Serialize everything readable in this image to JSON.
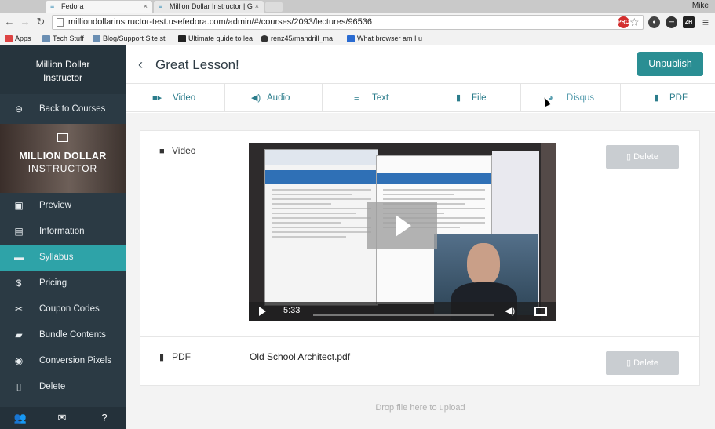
{
  "browser": {
    "tabs": [
      {
        "title": "Fedora",
        "active": true
      },
      {
        "title": "Million Dollar Instructor | G",
        "active": false
      }
    ],
    "user": "Mike",
    "url": "milliondollarinstructor-test.usefedora.com/admin/#/courses/2093/lectures/96536",
    "bookmarks": [
      "Apps",
      "Tech Stuff",
      "Blog/Support Site st",
      "Ultimate guide to lea",
      "renz45/mandrill_ma",
      "What browser am I u"
    ],
    "ext_labels": [
      "PRO",
      "ZH"
    ]
  },
  "sidebar": {
    "brand": "Million Dollar Instructor",
    "back": "Back to Courses",
    "logo_line1": "MILLION DOLLAR",
    "logo_line2": "INSTRUCTOR",
    "items": [
      {
        "label": "Preview",
        "icon": "image-icon"
      },
      {
        "label": "Information",
        "icon": "document-icon"
      },
      {
        "label": "Syllabus",
        "icon": "book-icon",
        "active": true
      },
      {
        "label": "Pricing",
        "icon": "dollar-icon"
      },
      {
        "label": "Coupon Codes",
        "icon": "scissors-icon"
      },
      {
        "label": "Bundle Contents",
        "icon": "folder-icon"
      },
      {
        "label": "Conversion Pixels",
        "icon": "target-icon"
      },
      {
        "label": "Delete",
        "icon": "trash-icon"
      }
    ]
  },
  "header": {
    "title": "Great Lesson!",
    "unpublish": "Unpublish"
  },
  "tabs": [
    {
      "label": "Video",
      "icon": "video-camera-icon"
    },
    {
      "label": "Audio",
      "icon": "speaker-icon"
    },
    {
      "label": "Text",
      "icon": "text-lines-icon"
    },
    {
      "label": "File",
      "icon": "file-icon"
    },
    {
      "label": "Disqus",
      "icon": "comments-icon"
    },
    {
      "label": "PDF",
      "icon": "pdf-icon"
    }
  ],
  "video_card": {
    "label": "Video",
    "delete": "Delete",
    "time": "5:33"
  },
  "pdf_card": {
    "label": "PDF",
    "filename": "Old School Architect.pdf",
    "delete": "Delete"
  },
  "drop_zone": "Drop file here to upload",
  "colors": {
    "sidebar_bg": "#2b3a44",
    "accent": "#2ea3a8",
    "button": "#2a8e93",
    "tab_text": "#2c7d8c"
  }
}
